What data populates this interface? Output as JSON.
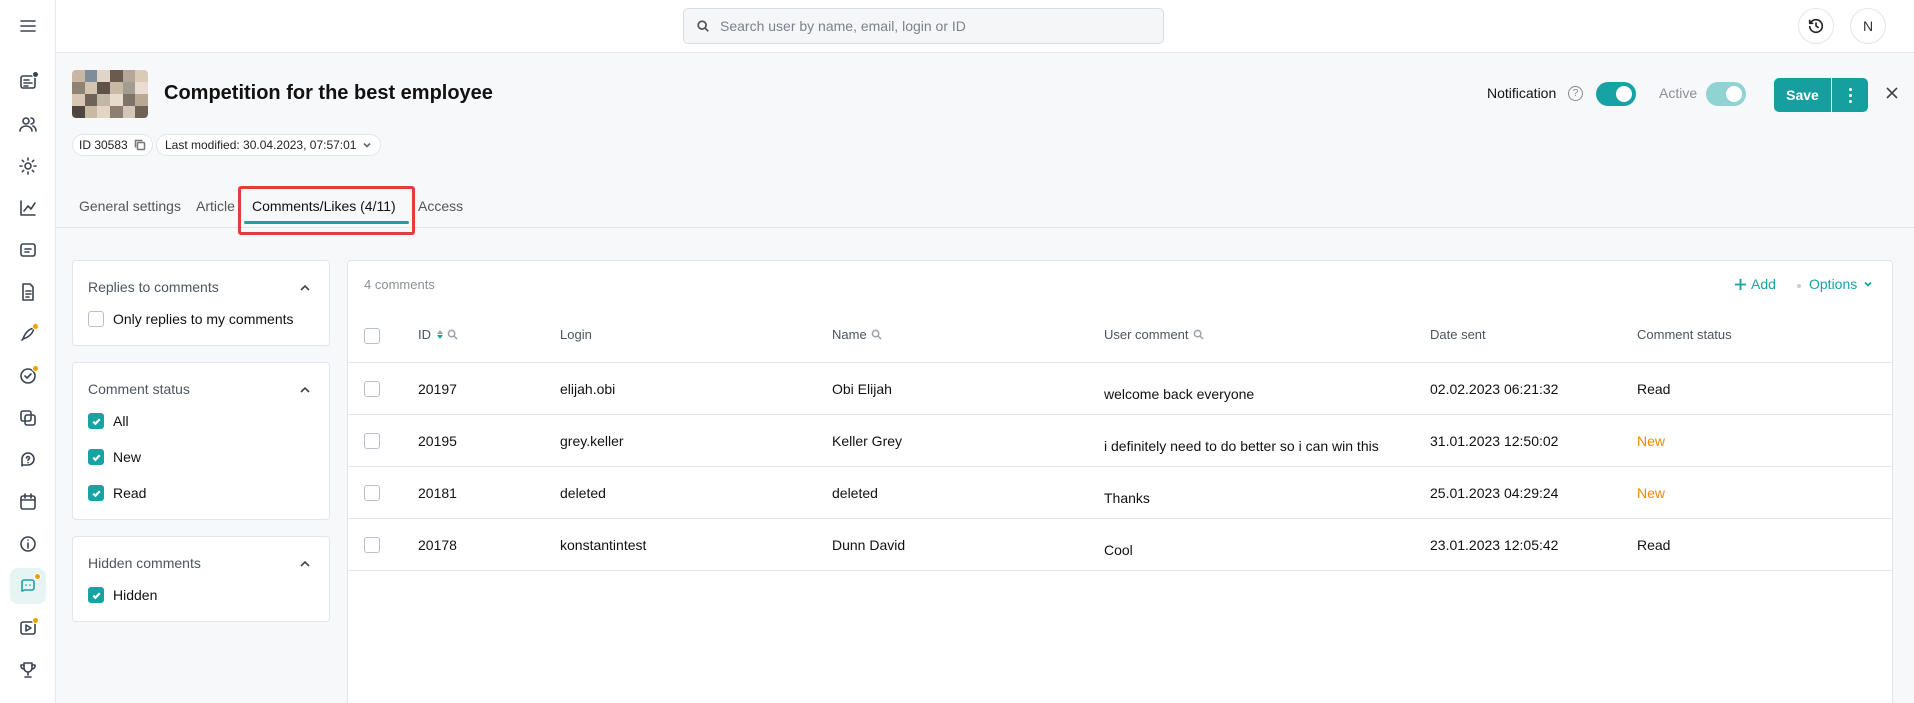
{
  "search": {
    "placeholder": "Search user by name, email, login or ID"
  },
  "user": {
    "initial": "N"
  },
  "header": {
    "title": "Competition for the best employee",
    "id_label": "ID 30583",
    "last_modified": "Last modified: 30.04.2023, 07:57:01",
    "notification_label": "Notification",
    "active_label": "Active",
    "save_label": "Save"
  },
  "tabs": [
    {
      "label": "General settings"
    },
    {
      "label": "Article"
    },
    {
      "label": "Comments/Likes (4/11)"
    },
    {
      "label": "Access"
    }
  ],
  "filters": {
    "replies": {
      "title": "Replies to comments",
      "items": [
        {
          "label": "Only replies to my comments",
          "checked": false
        }
      ]
    },
    "status": {
      "title": "Comment status",
      "items": [
        {
          "label": "All",
          "checked": true
        },
        {
          "label": "New",
          "checked": true
        },
        {
          "label": "Read",
          "checked": true
        }
      ]
    },
    "hidden": {
      "title": "Hidden comments",
      "items": [
        {
          "label": "Hidden",
          "checked": true
        }
      ]
    }
  },
  "table": {
    "count_label": "4 comments",
    "add_label": "Add",
    "options_label": "Options",
    "columns": [
      "ID",
      "Login",
      "Name",
      "User comment",
      "Date sent",
      "Comment status"
    ],
    "rows": [
      {
        "id": "20197",
        "login": "elijah.obi",
        "name": "Obi Elijah",
        "comment": "welcome back everyone",
        "date": "02.02.2023 06:21:32",
        "status": "Read"
      },
      {
        "id": "20195",
        "login": "grey.keller",
        "name": "Keller Grey",
        "comment": "i definitely need to do better so i can win this",
        "date": "31.01.2023 12:50:02",
        "status": "New"
      },
      {
        "id": "20181",
        "login": "deleted",
        "name": "deleted",
        "comment": "Thanks",
        "date": "25.01.2023 04:29:24",
        "status": "New"
      },
      {
        "id": "20178",
        "login": "konstantintest",
        "name": "Dunn David",
        "comment": "Cool",
        "date": "23.01.2023 12:05:42",
        "status": "Read"
      }
    ]
  },
  "colors": {
    "accent": "#17a3a3",
    "status_new": "#f08c00",
    "highlight": "#e23d3d"
  }
}
